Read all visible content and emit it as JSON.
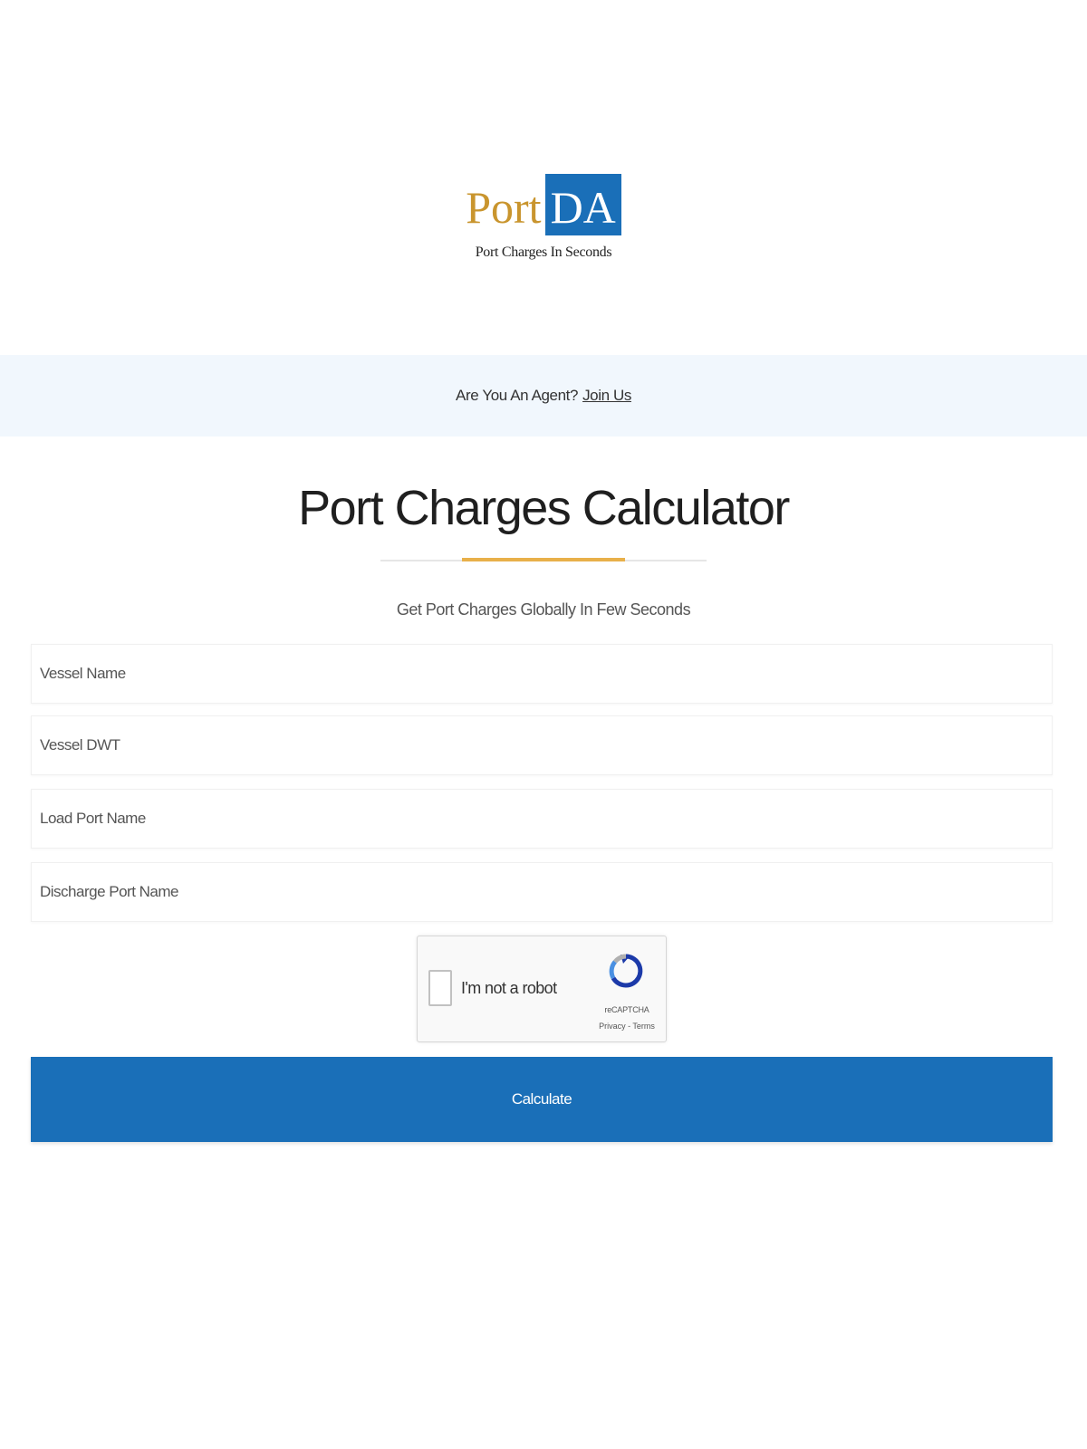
{
  "logo": {
    "port_text": "Port",
    "da_text": "DA",
    "tagline": "Port Charges In Seconds"
  },
  "banner": {
    "question": "Are You An Agent?",
    "link": "Join Us"
  },
  "calculator": {
    "title": "Port Charges Calculator",
    "subtitle": "Get Port Charges Globally In Few Seconds",
    "fields": {
      "vessel_name": {
        "placeholder": "Vessel Name",
        "value": ""
      },
      "vessel_dwt": {
        "placeholder": "Vessel DWT",
        "value": ""
      },
      "load_port": {
        "placeholder": "Load Port Name",
        "value": ""
      },
      "discharge_port": {
        "placeholder": "Discharge Port Name",
        "value": ""
      }
    },
    "recaptcha": {
      "label": "I'm not a robot",
      "brand": "reCAPTCHA",
      "links": "Privacy - Terms",
      "icon": "recaptcha-icon"
    },
    "submit_label": "Calculate"
  },
  "colors": {
    "brand_blue": "#1a6fb8",
    "brand_gold": "#c9952e",
    "accent_rule": "#e8b04a",
    "banner_bg": "#f1f7fd"
  }
}
